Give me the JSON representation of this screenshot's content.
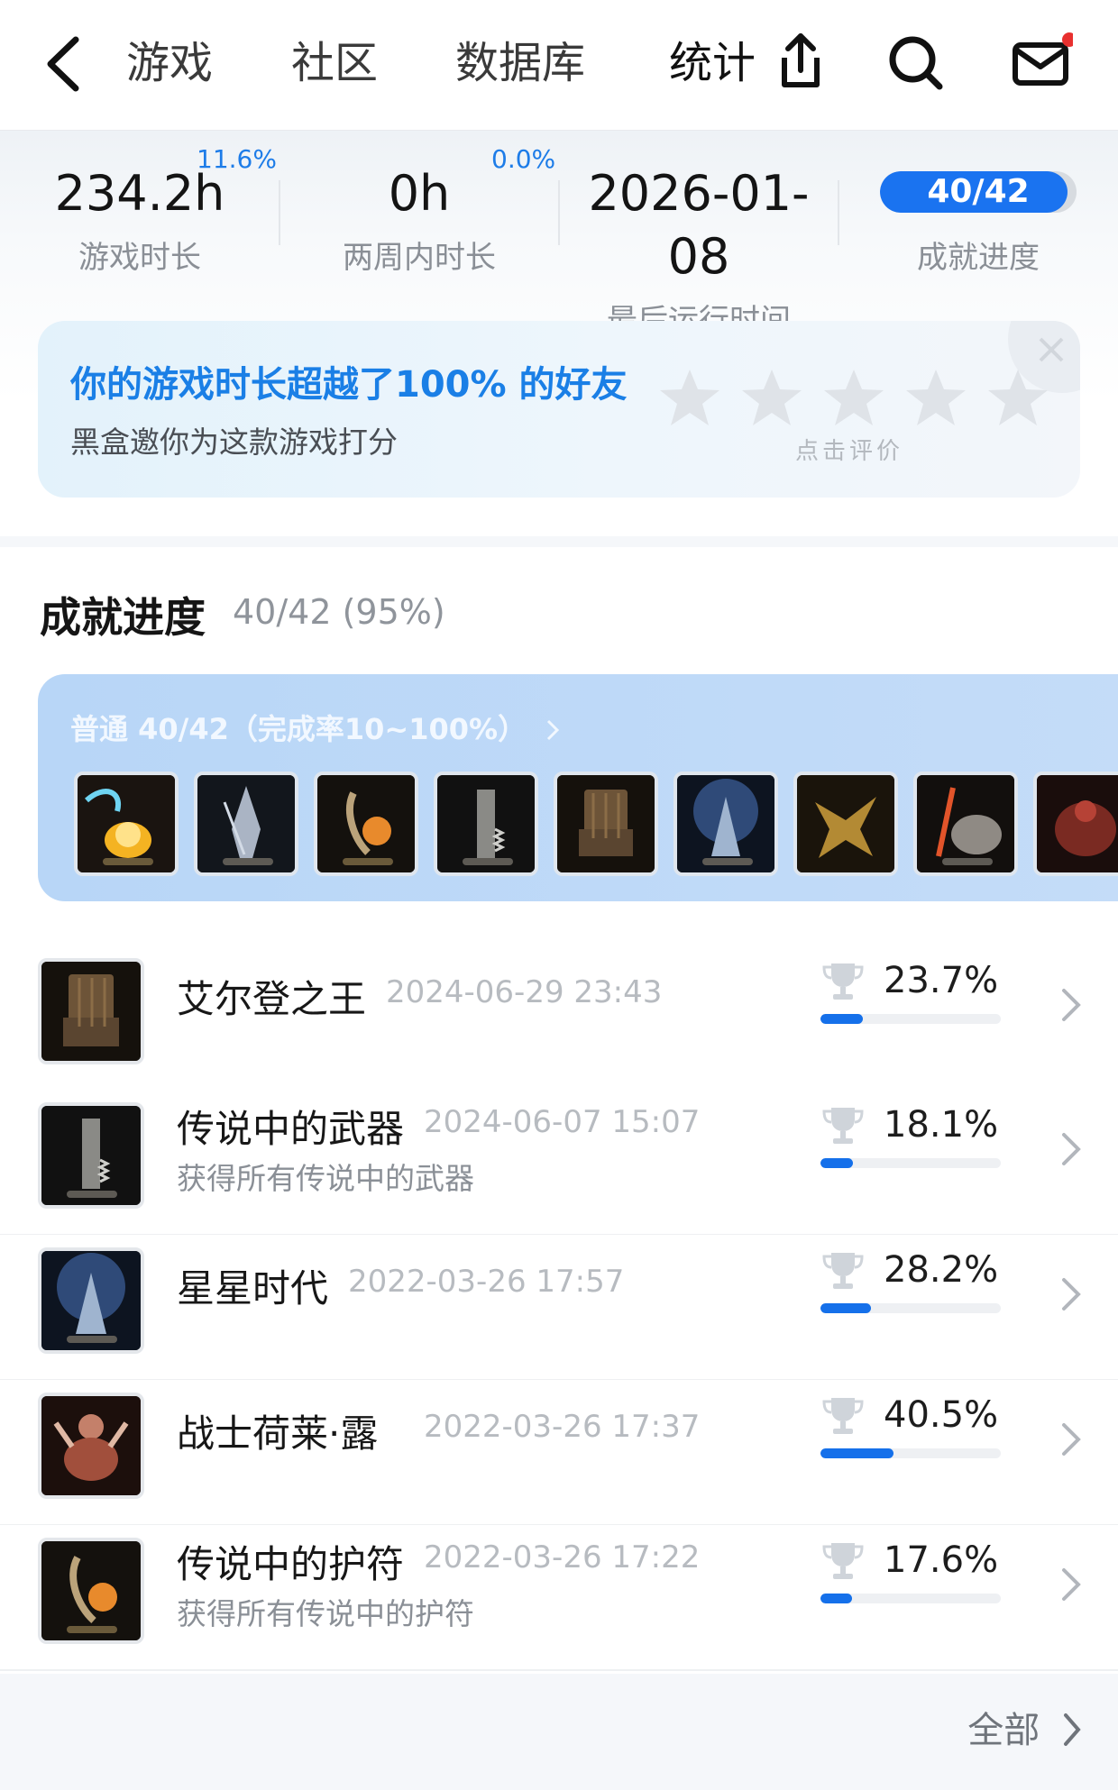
{
  "header": {
    "tabs": [
      {
        "label": "游戏"
      },
      {
        "label": "社区"
      },
      {
        "label": "数据库"
      },
      {
        "label": "统计"
      }
    ],
    "icons": [
      "back-icon",
      "share-icon",
      "search-icon",
      "mail-icon"
    ],
    "notification_dot_color": "#e8302f"
  },
  "stats": {
    "play_time": {
      "value": "234.2h",
      "label": "游戏时长",
      "delta": "11.6%"
    },
    "two_weeks": {
      "value": "0h",
      "label": "两周内时长",
      "delta": "0.0%"
    },
    "last_run": {
      "value": "2026-01-08",
      "label": "最后运行时间"
    },
    "achievement": {
      "value": "40/42",
      "label": "成就进度",
      "fraction": 0.952
    }
  },
  "rating_card": {
    "title": "你的游戏时长超越了100% 的好友",
    "subtitle": "黑盒邀你为这款游戏打分",
    "hint": "点击评价",
    "stars": 5
  },
  "achievements": {
    "title": "成就进度",
    "count": "40/42 (95%)",
    "tier_label": "普通 40/42（完成率10~100%）",
    "accent_color": "#1570ea",
    "items": [
      {
        "name": "艾尔登之王",
        "date": "2024-06-29 23:43",
        "desc": "",
        "percent": "23.7%",
        "ratio": 0.237
      },
      {
        "name": "传说中的武器",
        "date": "2024-06-07 15:07",
        "desc": "获得所有传说中的武器",
        "percent": "18.1%",
        "ratio": 0.181
      },
      {
        "name": "星星时代",
        "date": "2022-03-26 17:57",
        "desc": "",
        "percent": "28.2%",
        "ratio": 0.282
      },
      {
        "name": "战士荷莱·露",
        "date": "2022-03-26 17:37",
        "desc": "",
        "percent": "40.5%",
        "ratio": 0.405
      },
      {
        "name": "传说中的护符",
        "date": "2022-03-26 17:22",
        "desc": "获得所有传说中的护符",
        "percent": "17.6%",
        "ratio": 0.176
      }
    ],
    "see_all": "全部"
  }
}
